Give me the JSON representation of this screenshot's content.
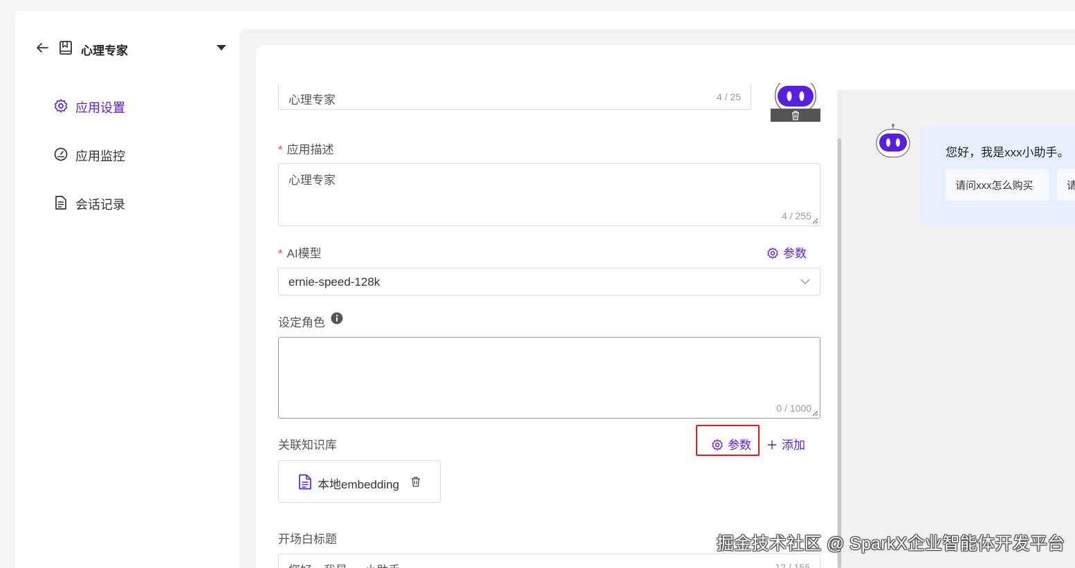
{
  "sidebar": {
    "title": "心理专家",
    "menu": [
      {
        "label": "应用设置",
        "icon": "gear-icon",
        "active": true
      },
      {
        "label": "应用监控",
        "icon": "gauge-icon",
        "active": false
      },
      {
        "label": "会话记录",
        "icon": "document-icon",
        "active": false
      }
    ]
  },
  "form": {
    "name": {
      "value": "心理专家",
      "counter": "4 / 25"
    },
    "description": {
      "label": "应用描述",
      "value": "心理专家",
      "counter": "4 / 255"
    },
    "model": {
      "label": "AI模型",
      "params_label": "参数",
      "value": "ernie-speed-128k"
    },
    "role": {
      "label": "设定角色",
      "value": "",
      "counter": "0 / 1000"
    },
    "knowledge": {
      "label": "关联知识库",
      "params_label": "参数",
      "add_label": "添加",
      "items": [
        {
          "name": "本地embedding"
        }
      ]
    },
    "opening_title": {
      "label": "开场白标题",
      "value": "您好，我是xxx小助手",
      "counter": "12 / 155"
    }
  },
  "preview": {
    "greeting": "您好，我是xxx小助手。",
    "suggestions": [
      "请问xxx怎么购买",
      "请"
    ]
  },
  "watermark": "掘金技术社区 @ SparkX企业智能体开发平台",
  "colors": {
    "accent": "#5b21d6",
    "required": "#e5484d",
    "highlight": "#e01b1b",
    "bubble": "#e9f0fd"
  }
}
